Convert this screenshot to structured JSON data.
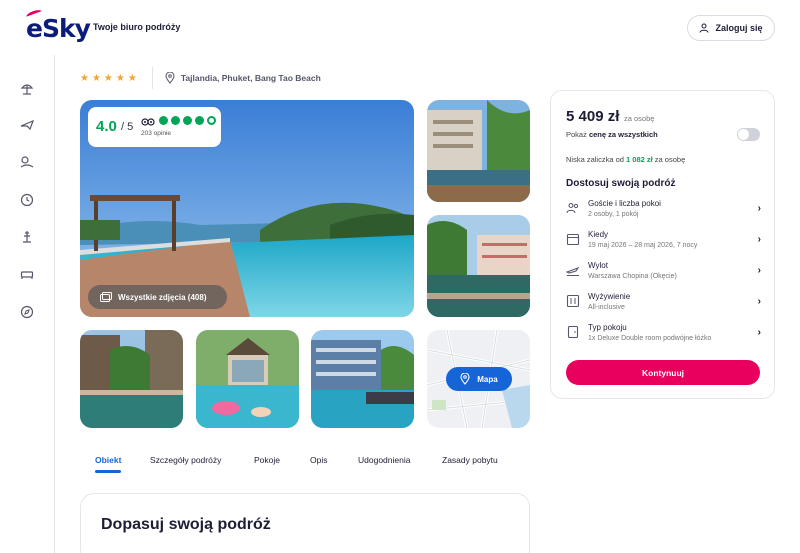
{
  "header": {
    "logo_text": "eSky",
    "tagline": "Twoje biuro podróży",
    "login_label": "Zaloguj się"
  },
  "sidebar": {
    "icons": [
      "beach-umbrella-icon",
      "plane-icon",
      "beach-icon",
      "clock-icon",
      "tour-icon",
      "bed-icon",
      "compass-icon"
    ]
  },
  "hotel": {
    "stars": "★★★★★",
    "location": "Tajlandia, Phuket, Bang Tao Beach"
  },
  "rating": {
    "score": "4.0",
    "of": "/ 5",
    "reviews": "203 opinie",
    "dots_filled": 4,
    "dots_total": 5
  },
  "gallery": {
    "all_photos_label": "Wszystkie zdjęcia (408)",
    "map_label": "Mapa"
  },
  "tabs": [
    {
      "label": "Obiekt",
      "active": true
    },
    {
      "label": "Szczegóły podróży"
    },
    {
      "label": "Pokoje"
    },
    {
      "label": "Opis"
    },
    {
      "label": "Udogodnienia"
    },
    {
      "label": "Zasady pobytu"
    }
  ],
  "adjust": {
    "title": "Dopasuj swoją podróż"
  },
  "booking": {
    "price": "5 409 zł",
    "price_per": "za osobę",
    "total_prefix": "Pokaż ",
    "total_bold": "cenę za wszystkich",
    "deposit_prefix": "Niska zaliczka od ",
    "deposit_amount": "1 082 zł",
    "deposit_suffix": " za osobę",
    "customize_title": "Dostosuj swoją podróż",
    "options": [
      {
        "label": "Goście i liczba pokoi",
        "value": "2 osoby, 1 pokój",
        "icon": "guests-icon"
      },
      {
        "label": "Kiedy",
        "value": "19 maj 2026 – 28 maj 2026, 7 nocy",
        "icon": "calendar-icon"
      },
      {
        "label": "Wylot",
        "value": "Warszawa Chopina (Okęcie)",
        "icon": "departure-icon"
      },
      {
        "label": "Wyżywienie",
        "value": "All-inclusive",
        "icon": "meal-icon"
      },
      {
        "label": "Typ pokoju",
        "value": "1x Deluxe Double room podwójne łóżko",
        "icon": "room-icon"
      }
    ],
    "continue_label": "Kontynuuj"
  },
  "colors": {
    "brand_pink": "#e9005f",
    "brand_blue": "#1565d8",
    "rating_green": "#00a656",
    "star_gold": "#f1a634"
  }
}
